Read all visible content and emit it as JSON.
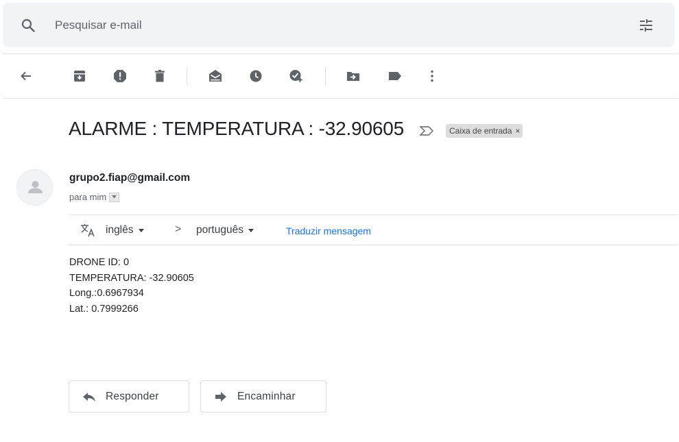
{
  "search": {
    "placeholder": "Pesquisar e-mail",
    "value": ""
  },
  "toolbar": {
    "icons": [
      "back-arrow-icon",
      "archive-icon",
      "report-spam-icon",
      "delete-icon",
      "mark-unread-icon",
      "snooze-icon",
      "add-task-icon",
      "move-to-icon",
      "labels-icon",
      "more-vert-icon"
    ]
  },
  "email": {
    "subject": "ALARME : TEMPERATURA : -32.90605",
    "label": "Caixa de entrada",
    "label_close": "×",
    "sender": "grupo2.fiap@gmail.com",
    "recipient": "para mim",
    "body_lines": [
      "DRONE ID: 0",
      "TEMPERATURA: -32.90605",
      "Long.:0.6967934",
      "Lat.: 0.7999266"
    ]
  },
  "translate": {
    "from_lang": "inglês",
    "arrow": ">",
    "to_lang": "português",
    "link": "Traduzir mensagem"
  },
  "actions": {
    "reply_label": "Responder",
    "forward_label": "Encaminhar"
  },
  "colors": {
    "search_bg": "#f1f3f4",
    "icon": "#5f6368",
    "link": "#1a73e8",
    "chip_bg": "#dddddd"
  }
}
